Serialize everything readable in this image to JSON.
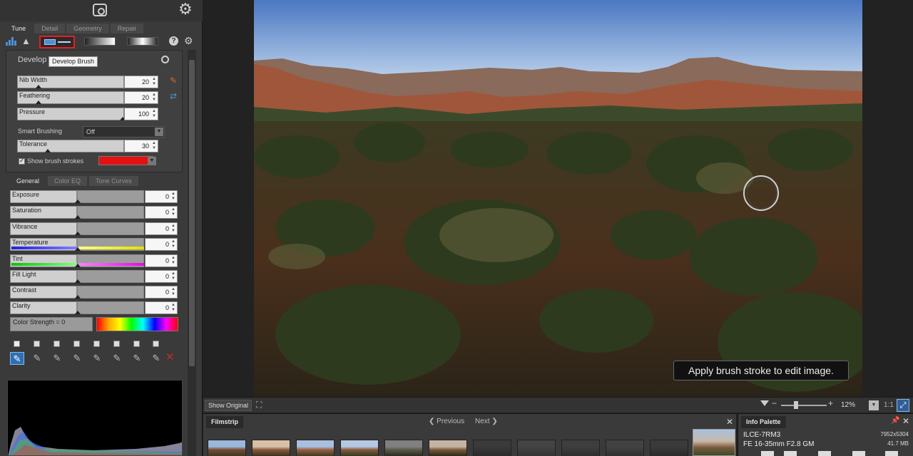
{
  "main_tabs": [
    "Tune",
    "Detail",
    "Geometry",
    "Repair"
  ],
  "tooltip": "Develop Brush",
  "brush_panel": {
    "title": "Develop",
    "sliders": [
      {
        "label": "Nib Width",
        "value": "20",
        "fill": 0.19
      },
      {
        "label": "Feathering",
        "value": "20",
        "fill": 0.19
      },
      {
        "label": "Pressure",
        "value": "100",
        "fill": 0.97
      },
      {
        "label": "Tolerance",
        "value": "30",
        "fill": 0.28
      }
    ],
    "smart_label": "Smart Brushing",
    "smart_value": "Off",
    "show_strokes_label": "Show brush strokes",
    "stroke_color": "#e51010"
  },
  "sub_tabs": [
    "General",
    "Color EQ",
    "Tone Curves"
  ],
  "adjustments": [
    {
      "label": "Exposure",
      "value": "0"
    },
    {
      "label": "Saturation",
      "value": "0"
    },
    {
      "label": "Vibrance",
      "value": "0"
    },
    {
      "label": "Temperature",
      "value": "0"
    },
    {
      "label": "Tint",
      "value": "0"
    },
    {
      "label": "Fill Light",
      "value": "0"
    },
    {
      "label": "Contrast",
      "value": "0"
    },
    {
      "label": "Clarity",
      "value": "0"
    }
  ],
  "color_strength": "Color Strength = 0",
  "toast": "Apply brush stroke to edit image.",
  "viewbar": {
    "show_original": "Show Original",
    "zoom": "12%",
    "one_to_one": "1:1"
  },
  "filmstrip": {
    "title": "Filmstrip",
    "previous": "Previous",
    "next": "Next"
  },
  "info": {
    "title": "Info Palette",
    "camera": "ILCE-7RM3",
    "lens": "FE 16-35mm F2.8 GM",
    "dimensions": "7952x5304",
    "file_size": "41.7 MB"
  },
  "colors": {
    "accent": "#4f8ed4",
    "highlight_red": "#e21f26",
    "panel": "#3a3a3a"
  }
}
